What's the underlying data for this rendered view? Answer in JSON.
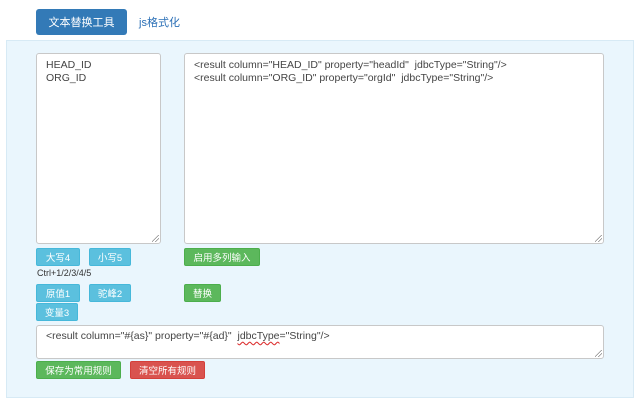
{
  "tabs": {
    "text_replace": "文本替换工具",
    "js_format": "js格式化"
  },
  "source_textarea": {
    "value": "HEAD_ID\nORG_ID"
  },
  "result_textarea": {
    "value": "<result column=\"HEAD_ID\" property=\"headId\"  jdbcType=\"String\"/>\n<result column=\"ORG_ID\" property=\"orgId\"  jdbcType=\"String\"/>"
  },
  "buttons": {
    "uppercase": "大写4",
    "lowercase": "小写5",
    "multi_column": "启用多列输入",
    "original": "原值1",
    "camel": "驼峰2",
    "replace": "替换",
    "variable3": "变量3",
    "save_rule": "保存为常用规则",
    "clear_rules": "清空所有规则"
  },
  "shortcut_hint": "Ctrl+1/2/3/4/5",
  "template_input": {
    "prefix": "<result column=\"#{as}\" property=\"#{ad}\"  ",
    "underlined": "jdbcType",
    "suffix": "=\"String\"/>"
  },
  "colors": {
    "primary": "#337ab7",
    "info": "#5bc0de",
    "success": "#5cb85c",
    "danger": "#d9534f",
    "panel_bg": "#eaf6fd"
  }
}
